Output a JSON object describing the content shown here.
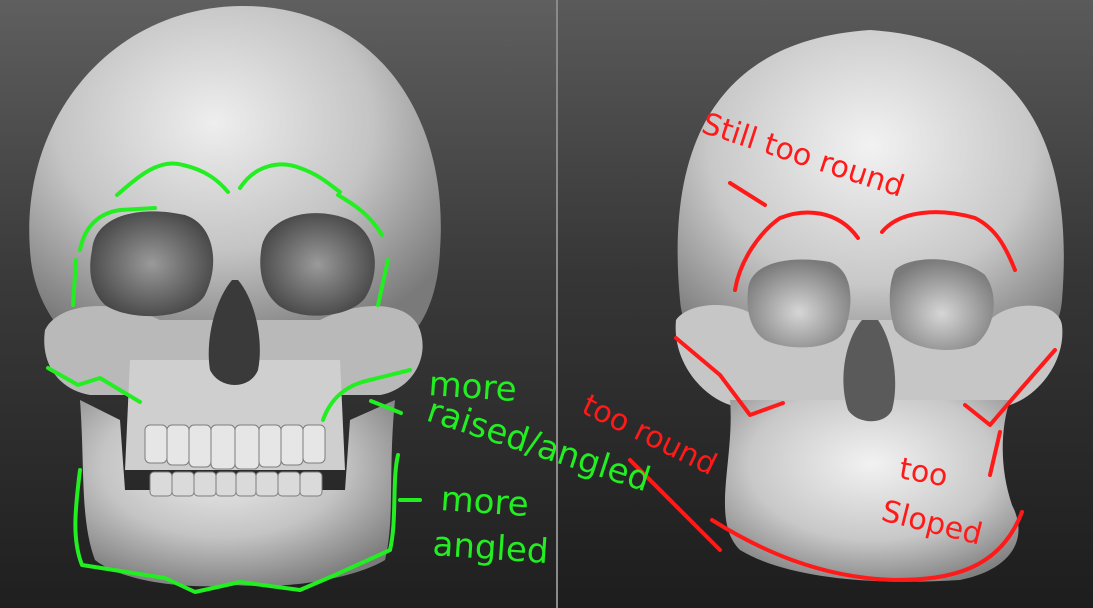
{
  "annotations_left": {
    "more_label": "more",
    "raised_angled_label": "raised/angled",
    "more_label_2": "more",
    "angled_label": "angled",
    "color": "#22ee22"
  },
  "annotations_right": {
    "still_too_round_label": "Still too round",
    "too_round_label": "too round",
    "too_label": "too",
    "sloped_label": "Sloped",
    "color": "#ff1a1a"
  },
  "colors": {
    "background_top": "#5f5f5f",
    "background_bottom": "#1f1f1f",
    "bone_light": "#e8e8e8",
    "bone_mid": "#b8b8b8",
    "bone_shadow": "#6a6a6a"
  }
}
